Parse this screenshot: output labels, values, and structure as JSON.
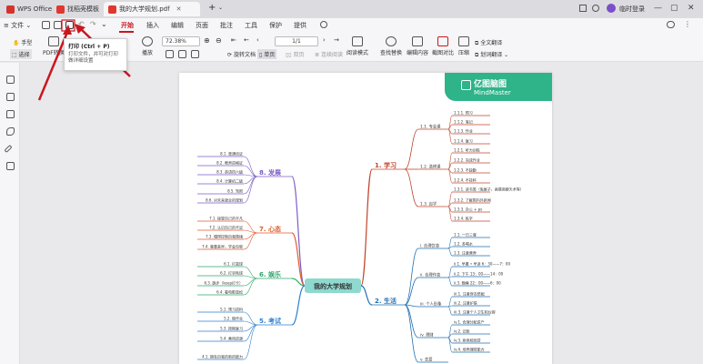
{
  "tabs": {
    "app": "WPS Office",
    "template": "找稻壳模板",
    "doc": "我的大学规划.pdf",
    "new_tab": "+"
  },
  "titlebar": {
    "login": "临时登录"
  },
  "menu": {
    "file": "文件",
    "items": [
      "开始",
      "插入",
      "编辑",
      "页面",
      "批注",
      "工具",
      "保护",
      "提供"
    ]
  },
  "toolbar": {
    "hand": "手型",
    "select": "选择",
    "pdf_convert": "PDF转换",
    "play": "播放",
    "zoom": "72.38%",
    "page_input": "1/1",
    "rotate": "旋转文档",
    "single": "单页",
    "double": "双页",
    "continuous": "连续阅读",
    "read_mode": "阅读模式",
    "find_replace": "查找替换",
    "edit_content": "编辑内容",
    "screenshot": "截图对比",
    "compress": "压缩",
    "full_translate": "全文翻译",
    "word_translate": "划词翻译"
  },
  "tooltip": {
    "title": "打印 (Ctrl + P)",
    "desc": "打印文件，并可对打印做详细设置"
  },
  "banner": {
    "cn": "亿图脑图",
    "en": "MindMaster"
  },
  "mindmap": {
    "root": "我的大学规划",
    "branches": {
      "study": "1. 学习",
      "life": "2. 生活",
      "develop": "8. 发展",
      "mind": "7. 心态",
      "fun": "6. 娱乐",
      "exam": "5. 考试"
    },
    "study_subs": [
      "1.1. 专业课",
      "1.2. 选修课",
      "1.3. 自学"
    ],
    "study_leaves": [
      "1.1.1. 预习",
      "1.1.2. 笔记",
      "1.1.3. 作业",
      "1.1.4. 复习",
      "1.2.1. 听力训练",
      "1.2.2. 完成作业",
      "1.2.3. 不缺勤",
      "1.2.4. 不挂科",
      "1.3.1. 读书类（兔尾子，高情商聊天术等）",
      "1.3.2. 了解国内外新闻",
      "1.3.3. 办公 + ps",
      "1.3.4. 练字"
    ],
    "life_subs": [
      "i. 合理饮食",
      "ii. 合理作息",
      "iii. 个人形象",
      "iv. 理财",
      "v. 恋爱"
    ],
    "life_leaves": [
      "1.1. 一日三餐",
      "1.2. 多喝水",
      "1.3. 注意营养",
      "ii.1. 早晨 • 早读 6：30——7：00",
      "ii.2. 下午 13：00——14：00",
      "ii.3. 晚睡 22：00——6：00",
      "iii.1. 注意穿衣搭配",
      "iii.2. 注意护肤",
      "iii.3. 注意个人卫生和仪容",
      "iv.1. 合理分配资产",
      "iv.2. 记账",
      "iv.3. 拒绝校园贷",
      "iv.4. 培养理财能力"
    ],
    "develop_leaves": [
      "8.1. 普通话证",
      "8.2. 教师资格证",
      "8.3. 英语四六级",
      "8.4. 计算机二级",
      "8.5. 驾照",
      "8.6. 对未来就业的规划"
    ],
    "mind_leaves": [
      "7.1. 接受自己的平凡",
      "7.2. 认识自己的不足",
      "7.3. 懂得控制自我情绪",
      "7.4. 尊重差异，学会包容"
    ],
    "fun_leaves": [
      "6.1. 打篮球",
      "6.2. 打羽毛球",
      "6.3. 跑步（keep打卡）",
      "6.4. 看电影放松"
    ],
    "exam_leaves": [
      "5.1. 预习资料",
      "5.2. 做作业",
      "5.3. 按期复习",
      "5.4. 善用资源",
      "4.1. 拥有自我的新的能力"
    ]
  },
  "colors": {
    "accent": "#c9171e",
    "banner": "#2fb388",
    "root": "#8fd9cf",
    "study": "#c0462b",
    "life": "#1f6fb2",
    "develop": "#7b5cc7",
    "mind": "#e05a2a",
    "fun": "#2fa66b",
    "exam": "#2e7fd0"
  }
}
